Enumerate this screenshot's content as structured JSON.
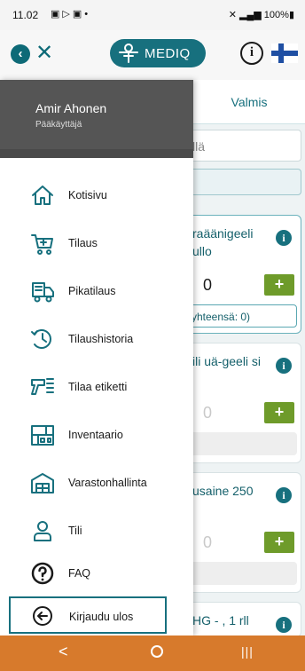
{
  "status_bar": {
    "time": "11.02",
    "left_icons": [
      "gallery-icon",
      "play-icon",
      "mail-icon",
      "dot-icon"
    ],
    "right_text": "100%",
    "right_icons": [
      "mute-icon",
      "hotspot-icon",
      "network-icon",
      "signal-icon",
      "battery-icon"
    ]
  },
  "header": {
    "logo_text": "MEDIQ",
    "back_icon": "chevron-left-icon",
    "close_icon": "close-icon",
    "info_icon": "info-icon",
    "language_flag": "finland-flag-icon"
  },
  "tabs": {
    "valmis": "Valmis"
  },
  "search": {
    "partial_text": "llä"
  },
  "products": [
    {
      "name": "raäänigeeli ullo",
      "quantity": "0",
      "total_text": "yhteensä: 0)"
    },
    {
      "name": "ili uä-geeli si",
      "quantity": "0",
      "total_text": ""
    },
    {
      "name": "usaine 250",
      "quantity": "0",
      "total_text": ""
    },
    {
      "name": "HG - , 1 rll",
      "quantity": "",
      "total_text": ""
    }
  ],
  "product_buttons": {
    "add": "+",
    "info": "i"
  },
  "drawer": {
    "user_name": "Amir Ahonen",
    "user_role": "Pääkäyttäjä",
    "items": [
      {
        "label": "Kotisivu",
        "icon": "home-icon"
      },
      {
        "label": "Tilaus",
        "icon": "cart-icon"
      },
      {
        "label": "Pikatilaus",
        "icon": "delivery-truck-icon"
      },
      {
        "label": "Tilaushistoria",
        "icon": "history-icon"
      },
      {
        "label": "Tilaa etiketti",
        "icon": "label-gun-icon"
      },
      {
        "label": "Inventaario",
        "icon": "warehouse-shelf-icon"
      },
      {
        "label": "Varastonhallinta",
        "icon": "warehouse-icon"
      },
      {
        "label": "Tili",
        "icon": "user-icon"
      },
      {
        "label": "FAQ",
        "icon": "question-icon"
      }
    ],
    "logout": {
      "label": "Kirjaudu ulos",
      "icon": "logout-arrow-icon"
    }
  },
  "nav_bar": {
    "back": "<",
    "recent": "|||"
  },
  "colors": {
    "brand_teal": "#17707e",
    "add_green": "#6e9b2a",
    "nav_orange": "#d77a2c",
    "drawer_header": "#555555"
  }
}
